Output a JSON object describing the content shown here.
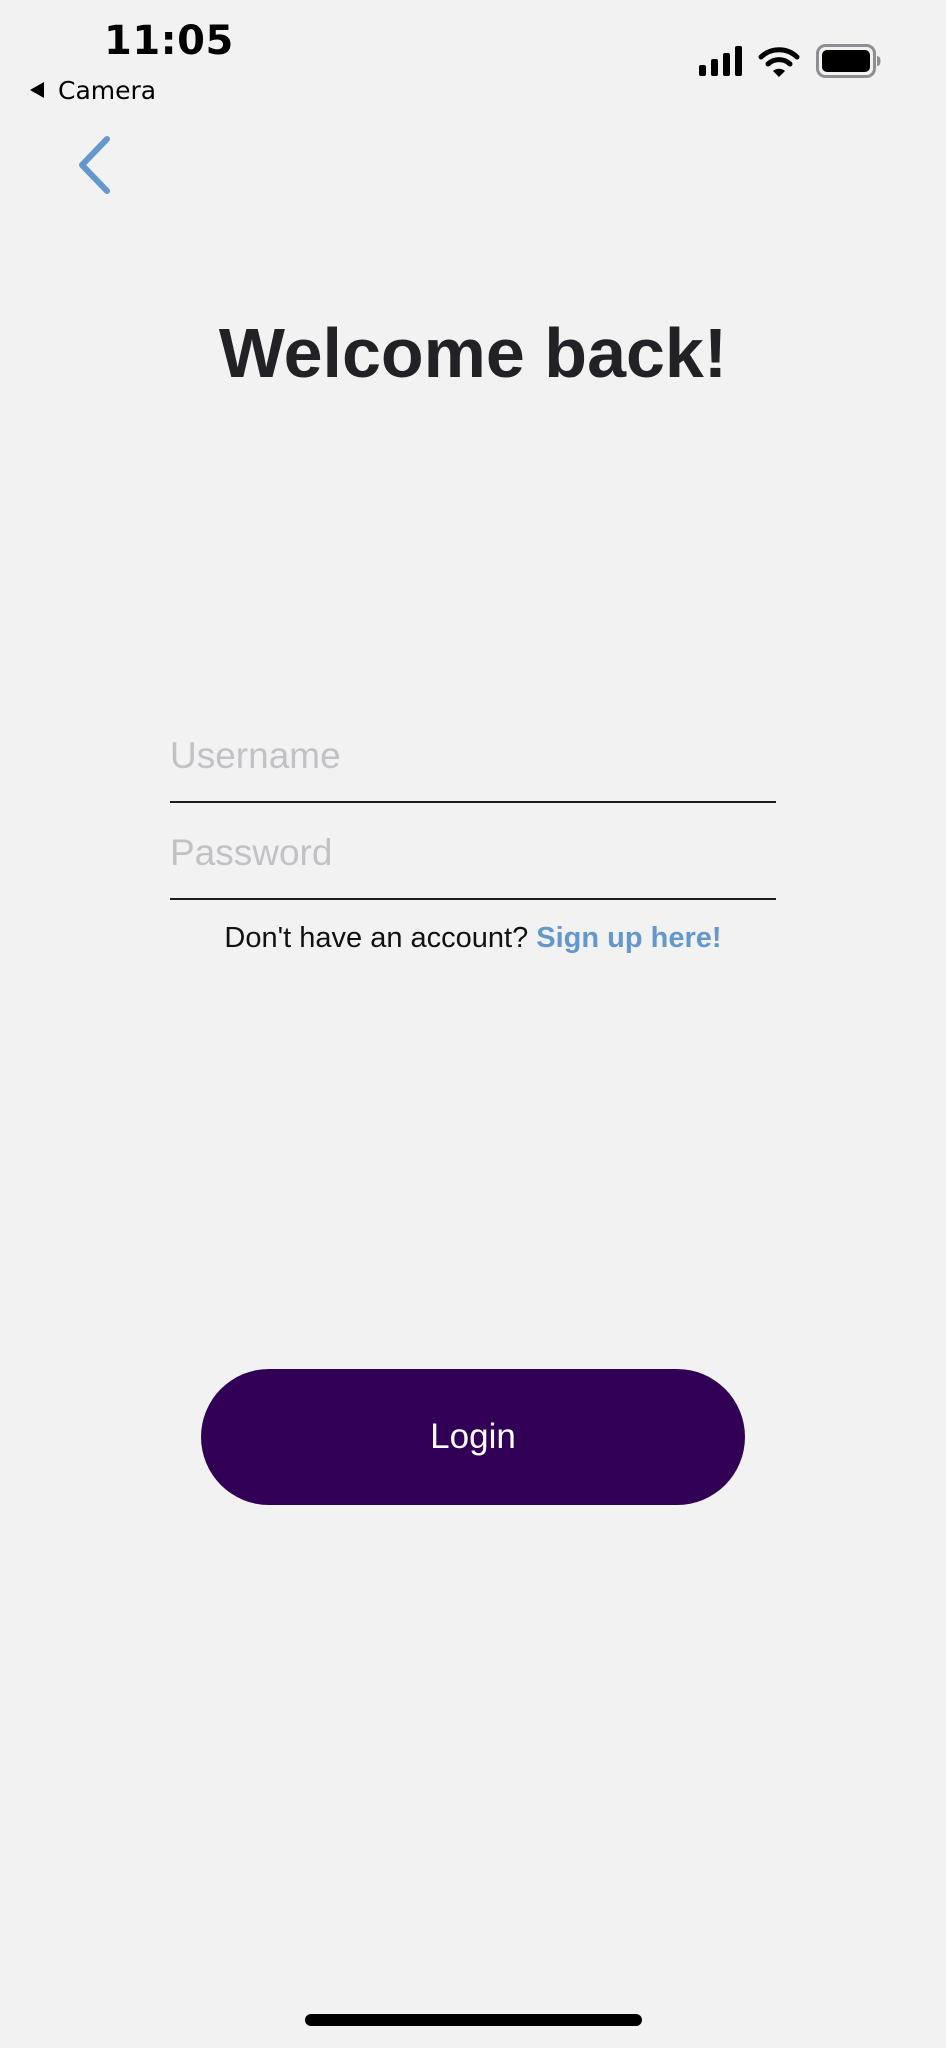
{
  "status_bar": {
    "time": "11:05",
    "back_app_label": "Camera",
    "icons": [
      "cellular-signal-icon",
      "wifi-icon",
      "battery-icon"
    ]
  },
  "nav": {
    "back_icon": "chevron-left-icon",
    "back_color": "#6498cd"
  },
  "header": {
    "title": "Welcome back!"
  },
  "form": {
    "username": {
      "placeholder": "Username",
      "value": ""
    },
    "password": {
      "placeholder": "Password",
      "value": ""
    }
  },
  "signup": {
    "prompt": "Don't have an account?",
    "link_label": "Sign up here!",
    "link_color": "#6498cd"
  },
  "actions": {
    "login_label": "Login",
    "login_color": "#310056"
  }
}
